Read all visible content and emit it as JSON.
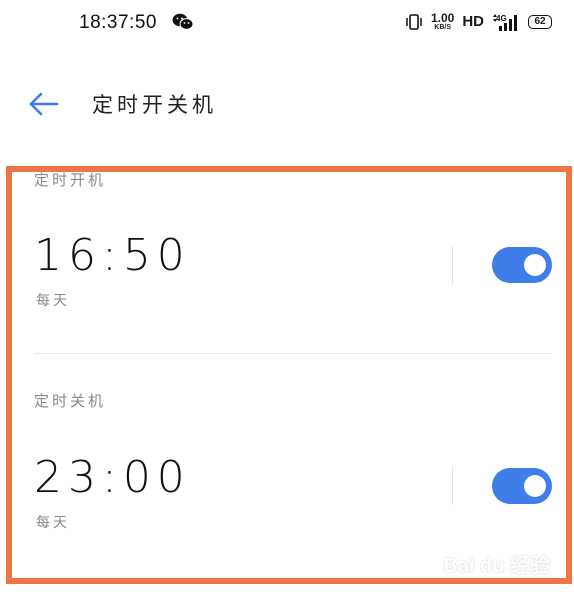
{
  "status_bar": {
    "time": "18:37:50",
    "icons": [
      "wechat-icon",
      "vibrate-icon",
      "signal-icon",
      "battery-icon"
    ],
    "net_speed_value": "1.00",
    "net_speed_unit": "KB/S",
    "hd": "HD",
    "network": "4G",
    "battery_level": "62"
  },
  "header": {
    "back_icon": "arrow-left-icon",
    "title": "定时开关机"
  },
  "power_on": {
    "label": "定时开机",
    "time": "16:50",
    "repeat": "每天",
    "enabled": true
  },
  "power_off": {
    "label": "定时关机",
    "time": "23:00",
    "repeat": "每天",
    "enabled": true
  },
  "colors": {
    "highlight_frame": "#ef7548",
    "toggle_on": "#3f7ee8",
    "back_arrow": "#3f7ee8"
  },
  "watermark": "Bai du 经验"
}
